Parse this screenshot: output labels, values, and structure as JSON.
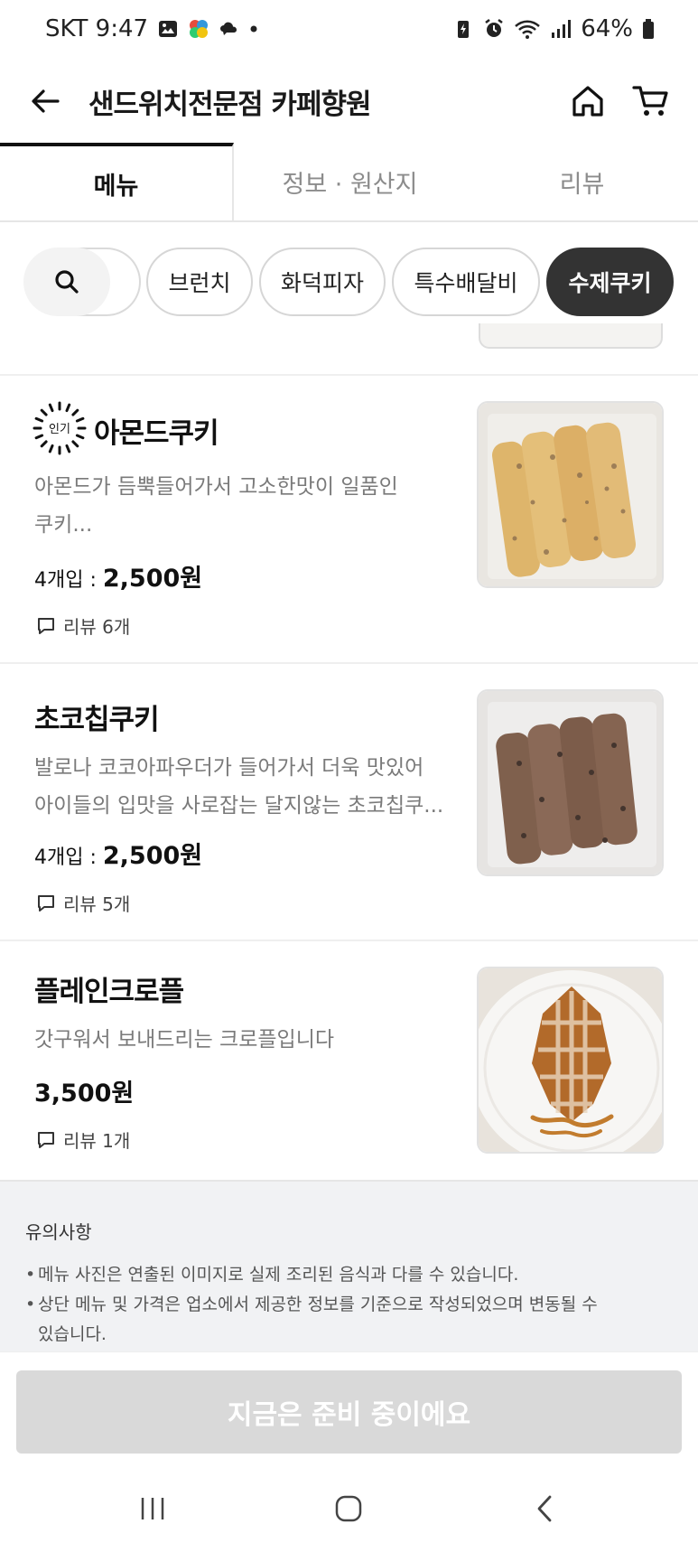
{
  "status_bar": {
    "carrier_time": "SKT 9:47",
    "battery": "64%",
    "icons": [
      "gallery-icon",
      "app-icon",
      "cloud-icon",
      "dot-icon",
      "battery-saver-icon",
      "alarm-icon",
      "wifi-icon",
      "signal-icon",
      "battery-icon"
    ]
  },
  "header": {
    "title": "샌드위치전문점 카페향원",
    "icons": [
      "back-arrow-icon",
      "home-icon",
      "cart-icon"
    ]
  },
  "tabs": [
    {
      "label": "메뉴",
      "active": true
    },
    {
      "label": "정보 · 원산지",
      "active": false
    },
    {
      "label": "리뷰",
      "active": false
    }
  ],
  "chips": [
    {
      "label": "브런치",
      "active": false
    },
    {
      "label": "화덕피자",
      "active": false
    },
    {
      "label": "특수배달비",
      "active": false
    },
    {
      "label": "수제쿠키",
      "active": true
    }
  ],
  "menu_items": [
    {
      "badge": "인기",
      "name": "아몬드쿠키",
      "desc_line1": "아몬드가 듬뿍들어가서 고소한맛이 일품인",
      "desc_line2": "쿠키...",
      "price_prefix": "4개입 : ",
      "price": "2,500원",
      "review": "리뷰 6개"
    },
    {
      "name": "초코칩쿠키",
      "desc_line1": "발로나 코코아파우더가 들어가서 더욱 맛있어",
      "desc_line2": "아이들의 입맛을 사로잡는 달지않는 초코칩쿠...",
      "price_prefix": "4개입 : ",
      "price": "2,500원",
      "review": "리뷰 5개"
    },
    {
      "name": "플레인크로플",
      "desc_line1": "갓구워서 보내드리는 크로플입니다",
      "price": "3,500원",
      "review": "리뷰 1개"
    }
  ],
  "notice": {
    "title": "유의사항",
    "line1": "메뉴 사진은 연출된 이미지로 실제 조리된 음식과 다를 수 있습니다.",
    "line2": "상단 메뉴 및 가격은 업소에서 제공한 정보를 기준으로 작성되었으며 변동될 수",
    "line2b": "있습니다."
  },
  "footer": {
    "order_button": "지금은 준비 중이에요"
  },
  "colors": {
    "active_chip": "#333333",
    "disabled_button": "#d9d9d9",
    "notice_bg": "#f1f2f4"
  }
}
